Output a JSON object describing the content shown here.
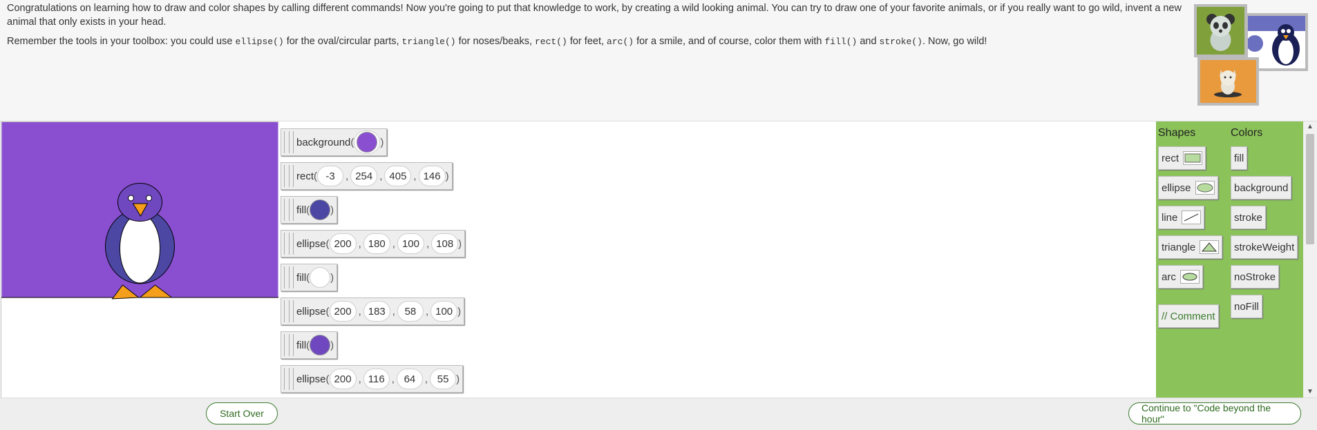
{
  "instructions": {
    "p1": "Congratulations on learning how to draw and color shapes by calling different commands! Now you're going to put that knowledge to work, by creating a wild looking animal. You can try to draw one of your favorite animals, or if you really want to go wild, invent a new animal that only exists in your head.",
    "p2_a": "Remember the tools in your toolbox: you could use ",
    "code_ellipse": "ellipse()",
    "p2_b": " for the oval/circular parts, ",
    "code_triangle": "triangle()",
    "p2_c": " for noses/beaks, ",
    "code_rect": "rect()",
    "p2_d": " for feet, ",
    "code_arc": "arc()",
    "p2_e": " for a smile, and of course, color them with ",
    "code_fill": "fill()",
    "p2_f": " and ",
    "code_stroke": "stroke()",
    "p2_g": ". Now, go wild!"
  },
  "colors": {
    "background_purple": "#8a4fd1",
    "body_blue": "#4b47a3",
    "head_purple": "#6f48c0",
    "belly_white": "#ffffff",
    "beak_orange": "#f59e1b",
    "toolbox_green": "#8bc25a",
    "button_green": "#3b7a2b"
  },
  "blocks": [
    {
      "fn": "background",
      "color": "#8a4fd1"
    },
    {
      "fn": "rect",
      "args": [
        "-3",
        "254",
        "405",
        "146"
      ]
    },
    {
      "fn": "fill",
      "color": "#4b47a3"
    },
    {
      "fn": "ellipse",
      "args": [
        "200",
        "180",
        "100",
        "108"
      ]
    },
    {
      "fn": "fill",
      "color": "#ffffff"
    },
    {
      "fn": "ellipse",
      "args": [
        "200",
        "183",
        "58",
        "100"
      ]
    },
    {
      "fn": "fill",
      "color": "#6f48c0"
    },
    {
      "fn": "ellipse",
      "args": [
        "200",
        "116",
        "64",
        "55"
      ]
    }
  ],
  "toolbox": {
    "shapes_header": "Shapes",
    "colors_header": "Colors",
    "shapes": [
      "rect",
      "ellipse",
      "line",
      "triangle",
      "arc"
    ],
    "comment": "// Comment",
    "colors": [
      "fill",
      "background",
      "stroke",
      "strokeWeight",
      "noStroke",
      "noFill"
    ]
  },
  "scroll": {
    "up": "▲",
    "down": "▼"
  },
  "footer": {
    "start_over": "Start Over",
    "continue": "Continue to \"Code beyond the hour\""
  }
}
